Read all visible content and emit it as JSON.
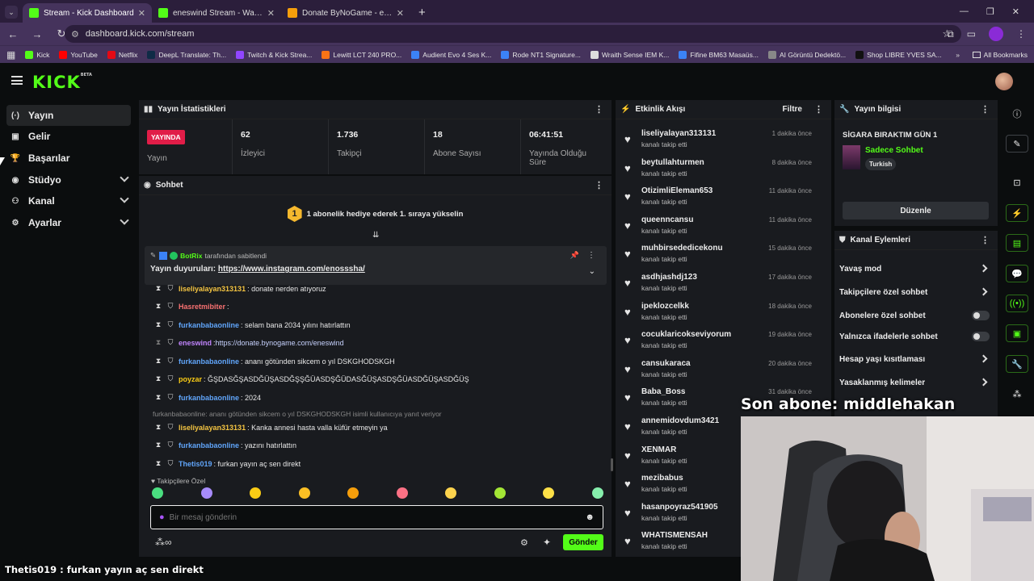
{
  "browser": {
    "tabs": [
      {
        "title": "Stream - Kick Dashboard",
        "favicon_color": "#53fc18",
        "active": true
      },
      {
        "title": "eneswind Stream - Watch Live o",
        "favicon_color": "#53fc18",
        "active": false
      },
      {
        "title": "Donate ByNoGame - eneswind",
        "favicon_color": "#f59e0b",
        "active": false
      }
    ],
    "url": "dashboard.kick.com/stream",
    "bookmarks": [
      {
        "label": "Kick",
        "icon_color": "#53fc18"
      },
      {
        "label": "YouTube",
        "icon_color": "#ff0000"
      },
      {
        "label": "Netflix",
        "icon_color": "#e50914"
      },
      {
        "label": "DeepL Translate: Th...",
        "icon_color": "#0f2b46"
      },
      {
        "label": "Twitch & Kick Strea...",
        "icon_color": "#9146ff"
      },
      {
        "label": "Lewitt LCT 240 PRO...",
        "icon_color": "#f97316"
      },
      {
        "label": "Audient Evo 4 Ses K...",
        "icon_color": "#3b82f6"
      },
      {
        "label": "Rode NT1 Signature...",
        "icon_color": "#3b82f6"
      },
      {
        "label": "Wraith Sense IEM K...",
        "icon_color": "#dddddd"
      },
      {
        "label": "Fifine BM63 Masaüs...",
        "icon_color": "#3b82f6"
      },
      {
        "label": "AI Görüntü Dedektö...",
        "icon_color": "#888888"
      },
      {
        "label": "Shop LIBRE YVES SA...",
        "icon_color": "#111111"
      }
    ],
    "all_bookmarks": "All Bookmarks"
  },
  "nav": {
    "logo": "KICK",
    "logo_sup": "BETA",
    "items": [
      {
        "label": "Yayın",
        "icon": "broadcast-icon",
        "glyph": "(·)",
        "active": true,
        "expandable": false
      },
      {
        "label": "Gelir",
        "icon": "wallet-icon",
        "glyph": "▣",
        "active": false,
        "expandable": false
      },
      {
        "label": "Başarılar",
        "icon": "trophy-icon",
        "glyph": "🏆",
        "active": false,
        "expandable": false
      },
      {
        "label": "Stüdyo",
        "icon": "studio-icon",
        "glyph": "◉",
        "active": false,
        "expandable": true
      },
      {
        "label": "Kanal",
        "icon": "users-icon",
        "glyph": "⚇",
        "active": false,
        "expandable": true
      },
      {
        "label": "Ayarlar",
        "icon": "gear-icon",
        "glyph": "⚙",
        "active": false,
        "expandable": true
      }
    ]
  },
  "stats": {
    "title": "Yayın İstatistikleri",
    "live_badge": "YAYINDA",
    "cells": [
      {
        "value": "",
        "label": "Yayın"
      },
      {
        "value": "62",
        "label": "İzleyici"
      },
      {
        "value": "1.736",
        "label": "Takipçi"
      },
      {
        "value": "18",
        "label": "Abone Sayısı"
      },
      {
        "value": "06:41:51",
        "label": "Yayında Olduğu Süre"
      }
    ]
  },
  "chat": {
    "title": "Sohbet",
    "goal_text": "1 abonelik hediye ederek 1. sıraya yükselin",
    "pinned_by_user": "BotRix",
    "pinned_by_suffix": "tarafından sabitlendi",
    "pinned_message_label": "Yayın duyuruları:",
    "pinned_message_link": "https://www.instagram.com/enosssha/",
    "messages": [
      {
        "user": "liseliyalayan313131",
        "color": "#f5c542",
        "text": ": donate nerden atıyoruz",
        "link": "",
        "timer": true
      },
      {
        "user": "Hasretmibiter",
        "color": "#f87171",
        "text": ":",
        "link": "",
        "timer": true
      },
      {
        "user": "furkanbabaonline",
        "color": "#60a5fa",
        "text": ": selam bana 2034 yılını hatırlattın",
        "link": "",
        "timer": true
      },
      {
        "user": "eneswind",
        "color": "#c084fc",
        "text": ": ",
        "link": "https://donate.bynogame.com/eneswind",
        "timer": false
      },
      {
        "user": "furkanbabaonline",
        "color": "#60a5fa",
        "text": ": ananı götünden sikcem o yıl DSKGHODSKGH",
        "link": "",
        "timer": true
      },
      {
        "user": "poyzar",
        "color": "#facc15",
        "text": ": ĞŞDASĞŞASDĞÜŞASDĞŞŞĞÜASDŞĞÜDASĞÜŞASDŞĞÜASDĞÜŞASDĞÜŞ",
        "link": "",
        "timer": true
      },
      {
        "user": "furkanbabaonline",
        "color": "#60a5fa",
        "text": ": 2024",
        "link": "",
        "timer": true
      },
      {
        "user": "liseliyalayan313131",
        "color": "#f5c542",
        "text": ": Kanka annesi hasta valla küfür etmeyin ya",
        "link": "",
        "timer": true
      },
      {
        "user": "furkanbabaonline",
        "color": "#60a5fa",
        "text": ": yazını hatırlattın",
        "link": "",
        "timer": true
      },
      {
        "user": "Thetis019",
        "color": "#60a5fa",
        "text": ": furkan yayın aç sen direkt",
        "link": "",
        "timer": true
      }
    ],
    "reply_note": "furkanbabaonline: ananı götünden sikcem o yıl DSKGHODSKGH isimli kullanıcıya yanıt veriyor",
    "followers_only_label": "Takipçilere Özel",
    "input_placeholder": "Bir mesaj gönderin",
    "infinity": "∞",
    "send_label": "Gönder"
  },
  "activity": {
    "title": "Etkinlik Akışı",
    "filter_label": "Filtre",
    "items": [
      {
        "name": "liseliyalayan313131",
        "sub": "kanalı takip etti",
        "time": "1 dakika önce"
      },
      {
        "name": "beytullahturmen",
        "sub": "kanalı takip etti",
        "time": "8 dakika önce"
      },
      {
        "name": "OtizimliEleman653",
        "sub": "kanalı takip etti",
        "time": "11 dakika önce"
      },
      {
        "name": "queenncansu",
        "sub": "kanalı takip etti",
        "time": "11 dakika önce"
      },
      {
        "name": "muhbirsededicekonu",
        "sub": "kanalı takip etti",
        "time": "15 dakika önce"
      },
      {
        "name": "asdhjashdj123",
        "sub": "kanalı takip etti",
        "time": "17 dakika önce"
      },
      {
        "name": "ipeklozcelkk",
        "sub": "kanalı takip etti",
        "time": "18 dakika önce"
      },
      {
        "name": "cocuklaricokseviyorum",
        "sub": "kanalı takip etti",
        "time": "19 dakika önce"
      },
      {
        "name": "cansukaraca",
        "sub": "kanalı takip etti",
        "time": "20 dakika önce"
      },
      {
        "name": "Baba_Boss",
        "sub": "kanalı takip etti",
        "time": "31 dakika önce"
      },
      {
        "name": "annemidovdum3421",
        "sub": "kanalı takip etti",
        "time": ""
      },
      {
        "name": "XENMAR",
        "sub": "kanalı takip etti",
        "time": ""
      },
      {
        "name": "mezibabus",
        "sub": "kanalı takip etti",
        "time": ""
      },
      {
        "name": "hasanpoyraz541905",
        "sub": "kanalı takip etti",
        "time": ""
      },
      {
        "name": "WHATISMENSAH",
        "sub": "kanalı takip etti",
        "time": ""
      }
    ]
  },
  "stream_info": {
    "title": "Yayın bilgisi",
    "stream_title": "SİGARA BIRAKTIM GÜN 1",
    "category": "Sadece Sohbet",
    "tag": "Turkish",
    "edit_label": "Düzenle"
  },
  "channel_actions": {
    "title": "Kanal Eylemleri",
    "rows": [
      {
        "label": "Yavaş mod",
        "kind": "arrow"
      },
      {
        "label": "Takipçilere özel sohbet",
        "kind": "arrow"
      },
      {
        "label": "Abonelere özel sohbet",
        "kind": "toggle"
      },
      {
        "label": "Yalnızca ifadelerle sohbet",
        "kind": "toggle"
      },
      {
        "label": "Hesap yaşı kısıtlaması",
        "kind": "arrow"
      },
      {
        "label": "Yasaklanmış kelimeler",
        "kind": "arrow"
      }
    ]
  },
  "overlay": {
    "last_sub": "Son abone: middlehakan",
    "bottom_chat": "Thetis019 : furkan yayın aç sen direkt"
  }
}
